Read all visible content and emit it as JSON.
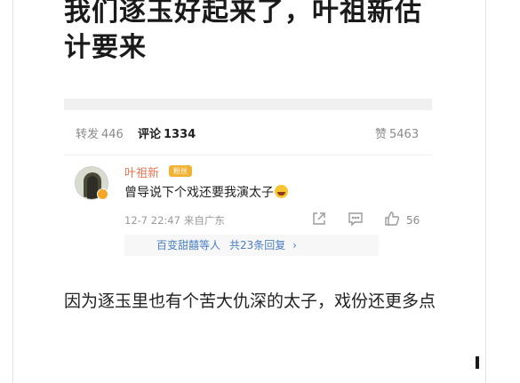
{
  "post": {
    "title": "我们逐玉好起来了，叶祖新估计要来"
  },
  "stats": {
    "repost_label": "转发",
    "repost_count": "446",
    "comment_label": "评论",
    "comment_count": "1334",
    "like_label": "赞",
    "like_count": "5463"
  },
  "comment": {
    "username": "叶祖新",
    "badge": "粉丝",
    "text": "曾导说下个戏还要我演太子",
    "date": "12-7 22:47",
    "source": "来自广东",
    "likes": "56",
    "replies": {
      "who": "百变甜囍等人",
      "count_text": "共23条回复",
      "chevron": "›"
    }
  },
  "body": {
    "text": "因为逐玉里也有个苦大仇深的太子，戏份还更多点"
  },
  "colors": {
    "username": "#eb7350",
    "link": "#4a7fc1",
    "badge": "#f2b233"
  },
  "icons": [
    "share-icon",
    "comment-icon",
    "like-icon",
    "laugh-emoji-icon",
    "chevron-right-icon"
  ]
}
